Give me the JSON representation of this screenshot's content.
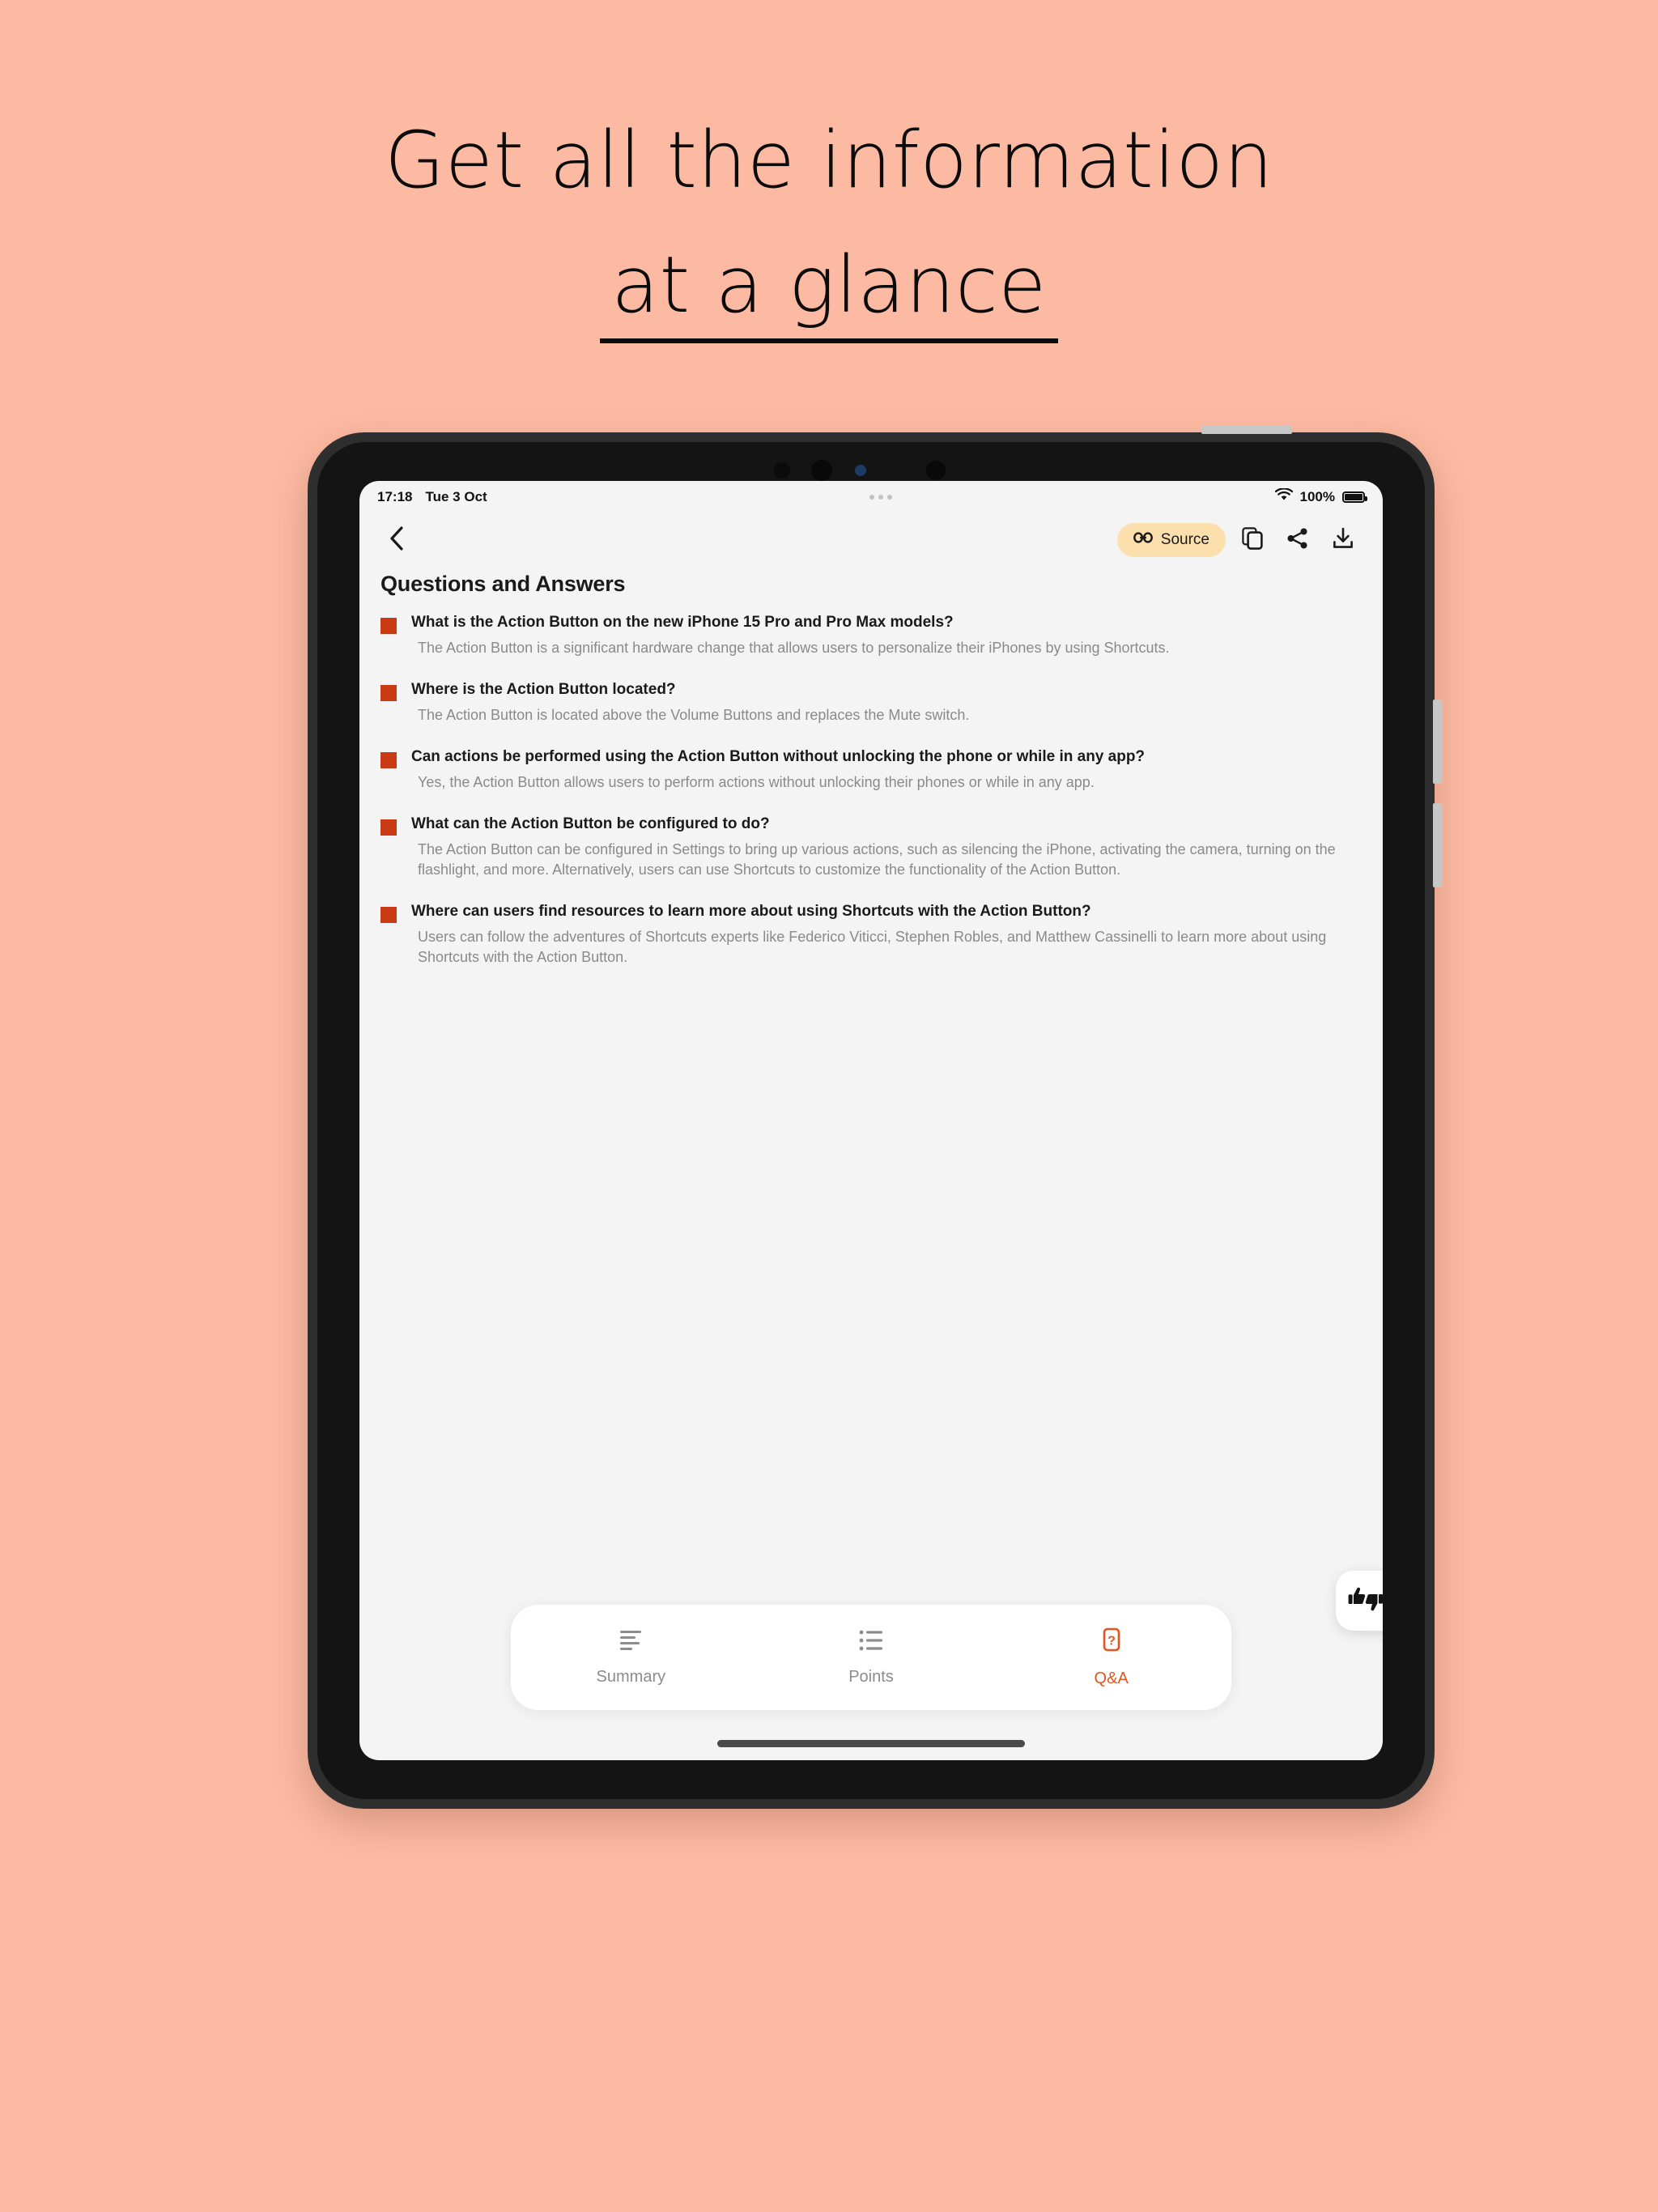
{
  "promo": {
    "headline_line1": "Get all the information",
    "headline_line2": "at a glance",
    "background_color": "#FCBAA3",
    "text_color": "#0B0B0B"
  },
  "status_bar": {
    "time": "17:18",
    "date": "Tue 3 Oct",
    "wifi_icon": "wifi-icon",
    "battery_percent": "100%",
    "battery_icon": "battery-full-icon"
  },
  "toolbar": {
    "back_icon": "chevron-left-icon",
    "source_label": "Source",
    "source_icon": "link-icon",
    "source_bg_color": "#FBE0AE",
    "copy_icon": "copy-icon",
    "share_icon": "share-icon",
    "download_icon": "download-icon"
  },
  "page": {
    "title": "Questions and Answers",
    "bullet_color": "#C93B14",
    "screen_bg_color": "#F4F4F4"
  },
  "qa": [
    {
      "question": "What is the Action Button on the new iPhone 15 Pro and Pro Max models?",
      "answer": "The Action Button is a significant hardware change that allows users to personalize their iPhones by using Shortcuts."
    },
    {
      "question": "Where is the Action Button located?",
      "answer": "The Action Button is located above the Volume Buttons and replaces the Mute switch."
    },
    {
      "question": "Can actions be performed using the Action Button without unlocking the phone or while in any app?",
      "answer": "Yes, the Action Button allows users to perform actions without unlocking their phones or while in any app."
    },
    {
      "question": "What can the Action Button be configured to do?",
      "answer": "The Action Button can be configured in Settings to bring up various actions, such as silencing the iPhone, activating the camera, turning on the flashlight, and more. Alternatively, users can use Shortcuts to customize the functionality of the Action Button."
    },
    {
      "question": "Where can users find resources to learn more about using Shortcuts with the Action Button?",
      "answer": "Users can follow the adventures of Shortcuts experts like Federico Viticci, Stephen Robles, and Matthew Cassinelli to learn more about using Shortcuts with the Action Button."
    }
  ],
  "feedback": {
    "icon": "thumbs-up-down-icon"
  },
  "tabs": [
    {
      "label": "Summary",
      "icon": "text-align-icon",
      "active": false
    },
    {
      "label": "Points",
      "icon": "list-icon",
      "active": false
    },
    {
      "label": "Q&A",
      "icon": "question-box-icon",
      "active": true
    }
  ],
  "accent_color": "#E8541F"
}
